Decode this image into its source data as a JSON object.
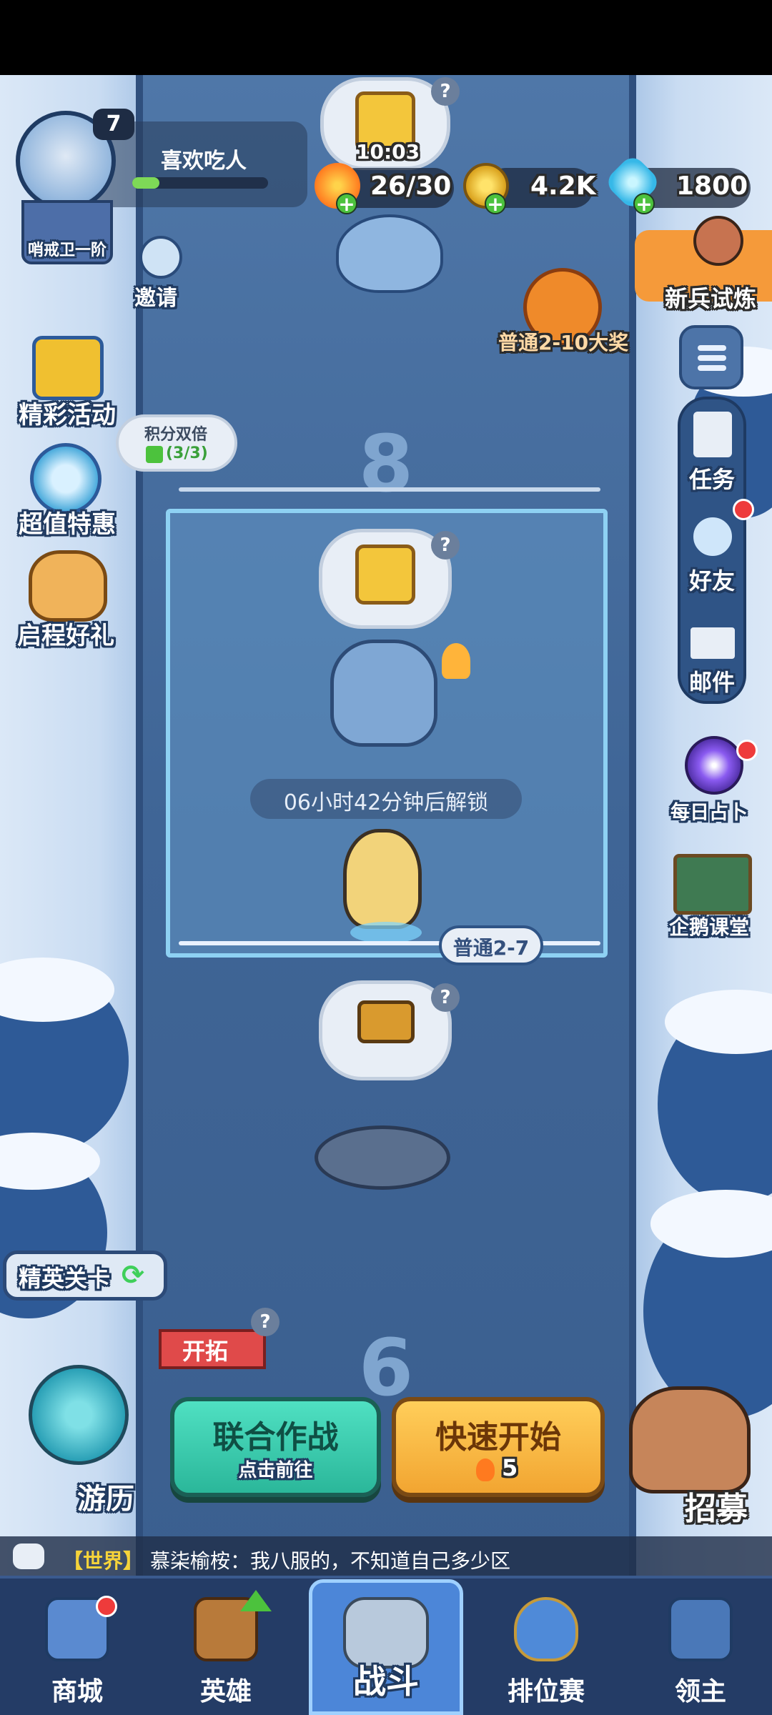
{
  "player": {
    "level": "7",
    "name": "喜欢吃人",
    "rank": "哨戒卫一阶",
    "xp_fraction": 0.2
  },
  "resources": {
    "timer": "10:03",
    "energy": "26/30",
    "gold": "4.2K",
    "gems": "1800"
  },
  "left_menu": {
    "invite": "邀请",
    "events": "精彩活动",
    "deals": "超值特惠",
    "journey_gift": "启程好礼",
    "score_double_title": "积分双倍",
    "score_double_count": "(3/3)"
  },
  "right_menu": {
    "rookie_trial": "新兵试炼",
    "reward_bubble": "普通2-10大奖",
    "tasks": "任务",
    "friends": "好友",
    "mail": "邮件",
    "daily_divination": "每日占卜",
    "penguin_class": "企鹅课堂"
  },
  "map": {
    "stage_upper_number": "8",
    "unlock_timer": "06小时42分钟后解锁",
    "current_stage_tag": "普通2-7",
    "stage_lower_number": "6",
    "elite_stages": "精英关卡",
    "expand_tag": "开拓",
    "travel": "游历",
    "recruit": "招募"
  },
  "actions": {
    "coop_title": "联合作战",
    "coop_sub": "点击前往",
    "quick_title": "快速开始",
    "quick_cost": "5"
  },
  "chat": {
    "channel": "【世界】",
    "message": "慕柒榆桉：我八服的，不知道自己多少区"
  },
  "tabs": [
    {
      "label": "商城"
    },
    {
      "label": "英雄"
    },
    {
      "label": "战斗"
    },
    {
      "label": "排位赛"
    },
    {
      "label": "领主"
    }
  ],
  "colors": {
    "river": "#3f6596",
    "snow": "#e4eef9",
    "coop_button": "#2bb79a",
    "quick_button": "#f2a531",
    "accent_orange": "#ff9b2f"
  }
}
